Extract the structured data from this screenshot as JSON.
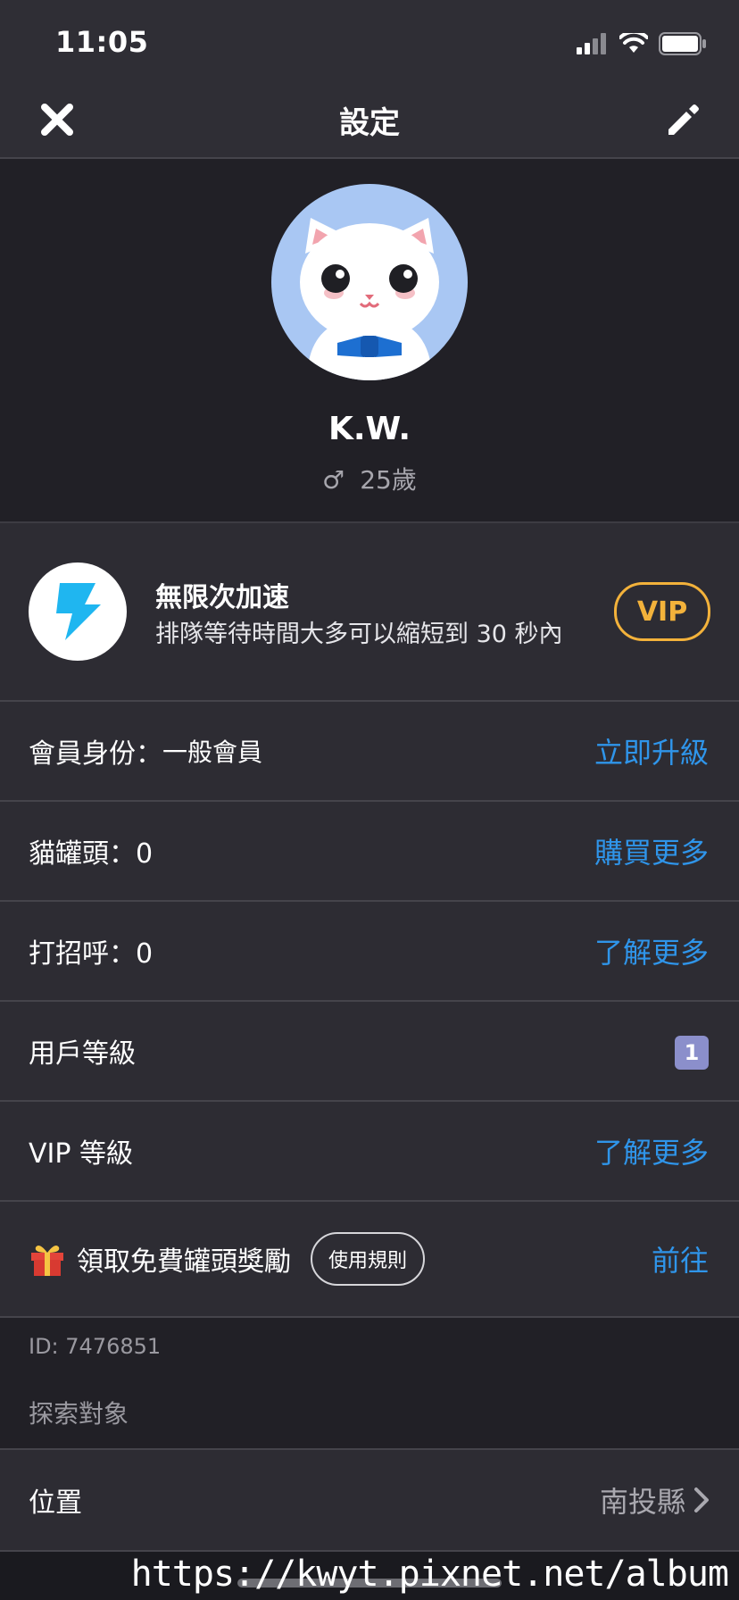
{
  "status_bar": {
    "time": "11:05"
  },
  "header": {
    "title": "設定"
  },
  "profile": {
    "name": "K.W.",
    "gender_symbol": "♂",
    "age": "25歲"
  },
  "vip_promo": {
    "title": "無限次加速",
    "description": "排隊等待時間大多可以縮短到 30 秒內",
    "badge": "VIP"
  },
  "rows": [
    {
      "label": "會員身份：",
      "value": "一般會員",
      "action": "立即升級"
    },
    {
      "label": "貓罐頭：0",
      "action": "購買更多"
    },
    {
      "label": "打招呼：0",
      "action": "了解更多"
    },
    {
      "label": "用戶等級",
      "level": "1"
    },
    {
      "label": "VIP 等級",
      "action": "了解更多"
    },
    {
      "label": "領取免費罐頭獎勵",
      "rule_button": "使用規則",
      "action": "前往"
    }
  ],
  "account": {
    "id_text": "ID: 7476851"
  },
  "explore": {
    "section_title": "探索對象",
    "location_label": "位置",
    "location_value": "南投縣"
  },
  "watermark": "https://kwyt.pixnet.net/album",
  "colors": {
    "background": "#2b2a31",
    "accent_blue": "#2f95ea",
    "vip_gold": "#f3b23b",
    "bolt_cyan": "#1fb6f0"
  }
}
